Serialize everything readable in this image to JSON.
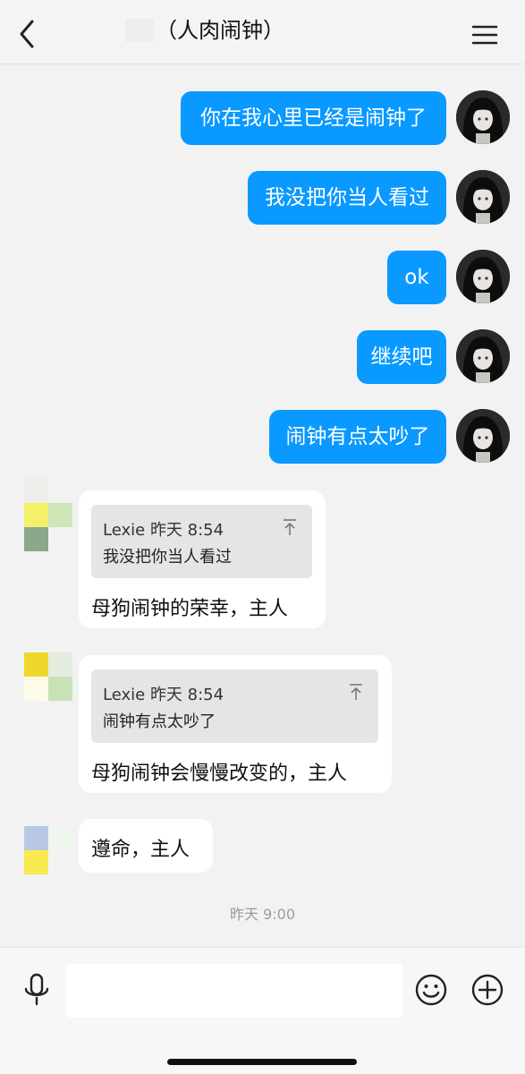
{
  "header": {
    "title": "（人肉闹钟）"
  },
  "outgoing": [
    {
      "text": "你在我心里已经是闹钟了"
    },
    {
      "text": "我没把你当人看过"
    },
    {
      "text": "ok"
    },
    {
      "text": "继续吧"
    },
    {
      "text": "闹钟有点太吵了"
    }
  ],
  "incoming": [
    {
      "quote_sender": "Lexie",
      "quote_time": "昨天 8:54",
      "quote_text": "我没把你当人看过",
      "text": "母狗闹钟的荣幸，主人"
    },
    {
      "quote_sender": "Lexie",
      "quote_time": "昨天 8:54",
      "quote_text": "闹钟有点太吵了",
      "text": "母狗闹钟会慢慢改变的，主人"
    },
    {
      "text": "遵命，主人"
    }
  ],
  "timestamp": "昨天 9:00",
  "input": {
    "value": "",
    "placeholder": ""
  },
  "icons": {
    "back": "chevron-left-icon",
    "menu": "hamburger-menu-icon",
    "voice": "microphone-icon",
    "emoji": "smiley-icon",
    "more": "plus-circle-icon",
    "quote_jump": "jump-to-quote-icon"
  },
  "colors": {
    "outgoing_bubble": "#0a99ff",
    "incoming_bubble": "#ffffff",
    "background": "#f2f2f2",
    "quote_background": "#e5e5e5"
  }
}
